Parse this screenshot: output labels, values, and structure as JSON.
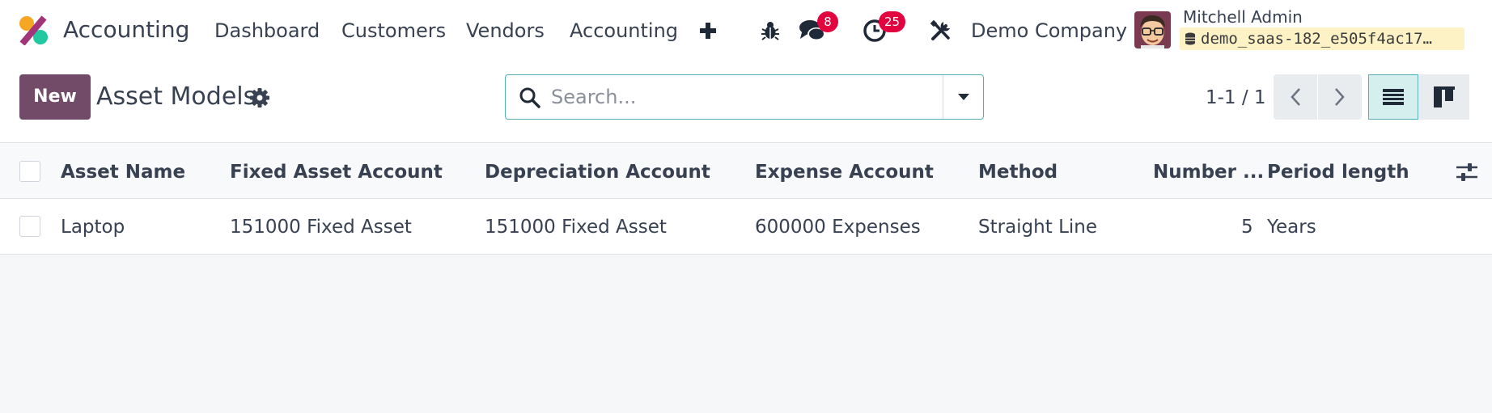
{
  "navbar": {
    "app_name": "Accounting",
    "menu": [
      "Dashboard",
      "Customers",
      "Vendors",
      "Accounting"
    ],
    "messages_count": "8",
    "activities_count": "25",
    "company": "Demo Company",
    "user_name": "Mitchell Admin",
    "database": "demo_saas-182_e505f4ac17…"
  },
  "control_panel": {
    "new_label": "New",
    "title": "Asset Models",
    "search_placeholder": "Search...",
    "pager": "1-1 / 1"
  },
  "table": {
    "columns": [
      "Asset Name",
      "Fixed Asset Account",
      "Depreciation Account",
      "Expense Account",
      "Method",
      "Number ...",
      "Period length"
    ],
    "rows": [
      [
        "Laptop",
        "151000 Fixed Asset",
        "151000 Fixed Asset",
        "600000 Expenses",
        "Straight Line",
        "5",
        "Years"
      ]
    ]
  },
  "colors": {
    "brand": "#714b67",
    "accent": "#54b1b6",
    "badge": "#e2043f"
  }
}
